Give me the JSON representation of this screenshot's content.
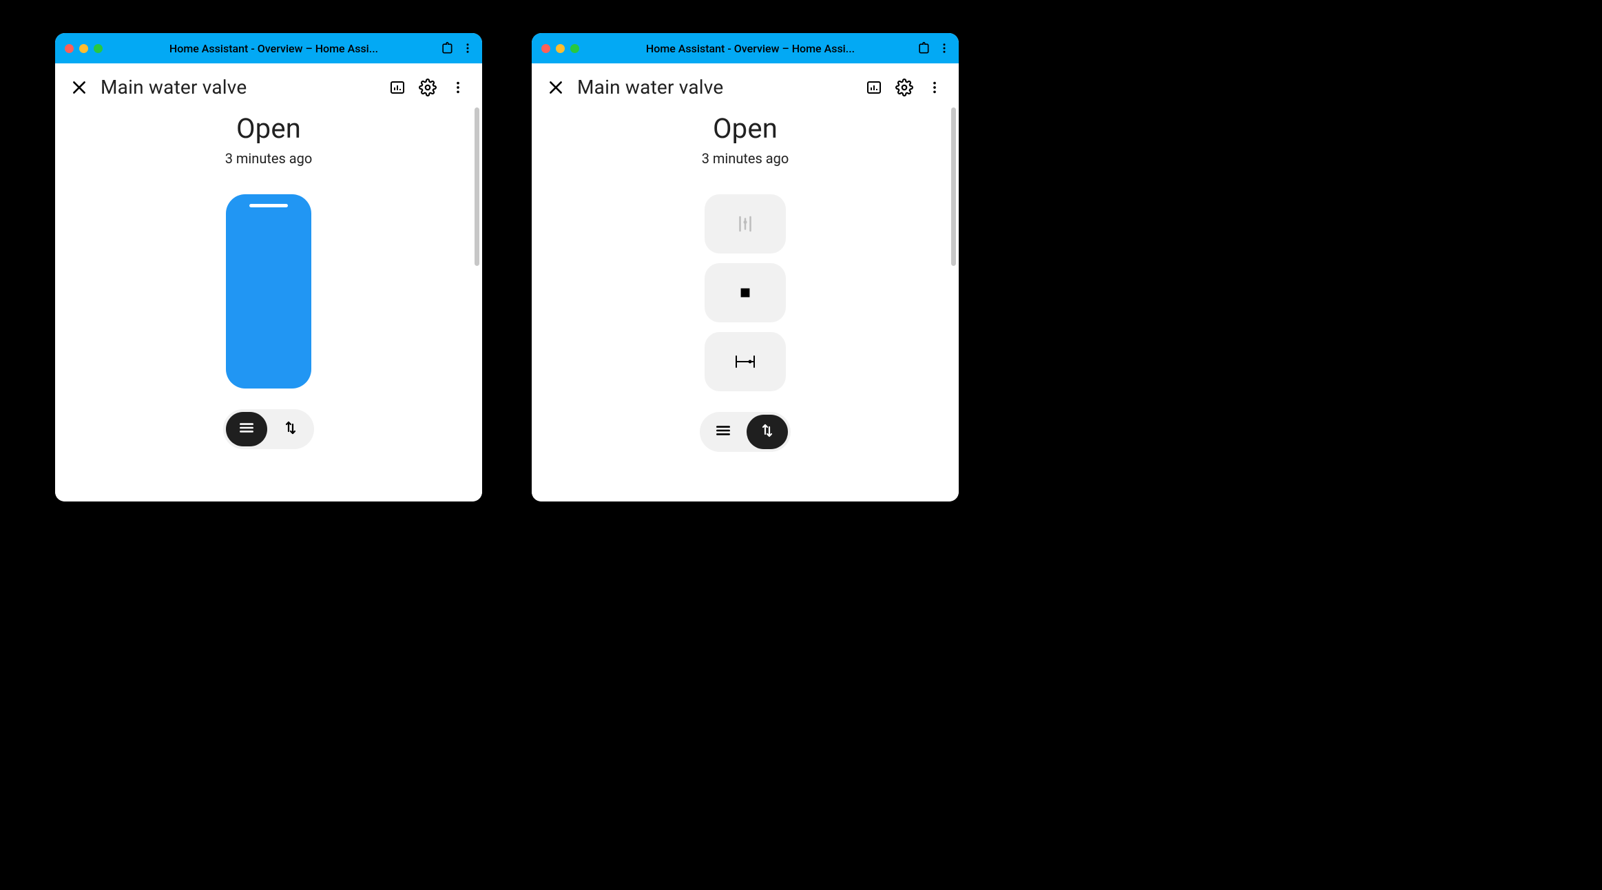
{
  "windows": [
    {
      "titlebar": {
        "title": "Home Assistant - Overview – Home Assi..."
      },
      "dialog": {
        "title": "Main water valve",
        "state": "Open",
        "last_changed": "3 minutes ago",
        "mode_selected": "slider"
      }
    },
    {
      "titlebar": {
        "title": "Home Assistant - Overview – Home Assi..."
      },
      "dialog": {
        "title": "Main water valve",
        "state": "Open",
        "last_changed": "3 minutes ago",
        "mode_selected": "buttons"
      }
    }
  ],
  "icons": {
    "close": "close-icon",
    "history_chart": "chart-bar-icon",
    "settings": "gear-icon",
    "more": "dots-vertical-icon",
    "extensions": "puzzle-icon",
    "valve_open": "valve-open-icon",
    "stop": "stop-icon",
    "valve_close": "valve-close-icon",
    "mode_slider": "menu-icon",
    "mode_buttons": "swap-vertical-icon"
  },
  "colors": {
    "titlebar": "#03a9f4",
    "slider_fill": "#2196f3",
    "button_bg": "#f1f1f1",
    "active_seg": "#1f1f1f"
  }
}
